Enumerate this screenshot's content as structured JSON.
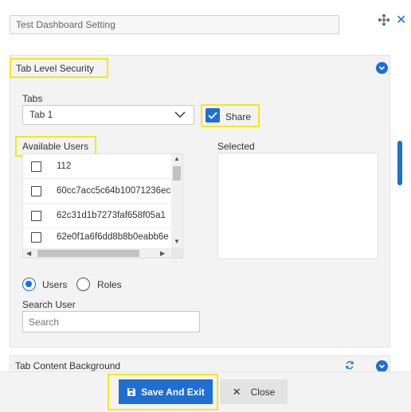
{
  "dialog": {
    "title_value": "Test Dashboard Setting",
    "icons": [
      "move-icon",
      "close-icon"
    ]
  },
  "section_security": {
    "header": "Tab Level Security",
    "tabs_label": "Tabs",
    "tab_selected": "Tab 1",
    "share_label": "Share",
    "share_checked": true,
    "available_users_label": "Available Users",
    "selected_label": "Selected",
    "users": [
      {
        "label": "112",
        "checked": false
      },
      {
        "label": "60cc7acc5c64b10071236ec",
        "checked": false
      },
      {
        "label": "62c31d1b7273faf658f05a1",
        "checked": false
      },
      {
        "label": "62e0f1a6f6dd8b8b0eabb6e",
        "checked": false
      }
    ],
    "radio_users": "Users",
    "radio_roles": "Roles",
    "radio_selected": "Users",
    "search_label": "Search User",
    "search_placeholder": "Search"
  },
  "section_content": {
    "header": "Tab Content Background"
  },
  "footer": {
    "save_label": "Save And Exit",
    "close_label": "Close"
  },
  "colors": {
    "accent": "#1e6fd1",
    "highlight": "#f2e91d"
  }
}
